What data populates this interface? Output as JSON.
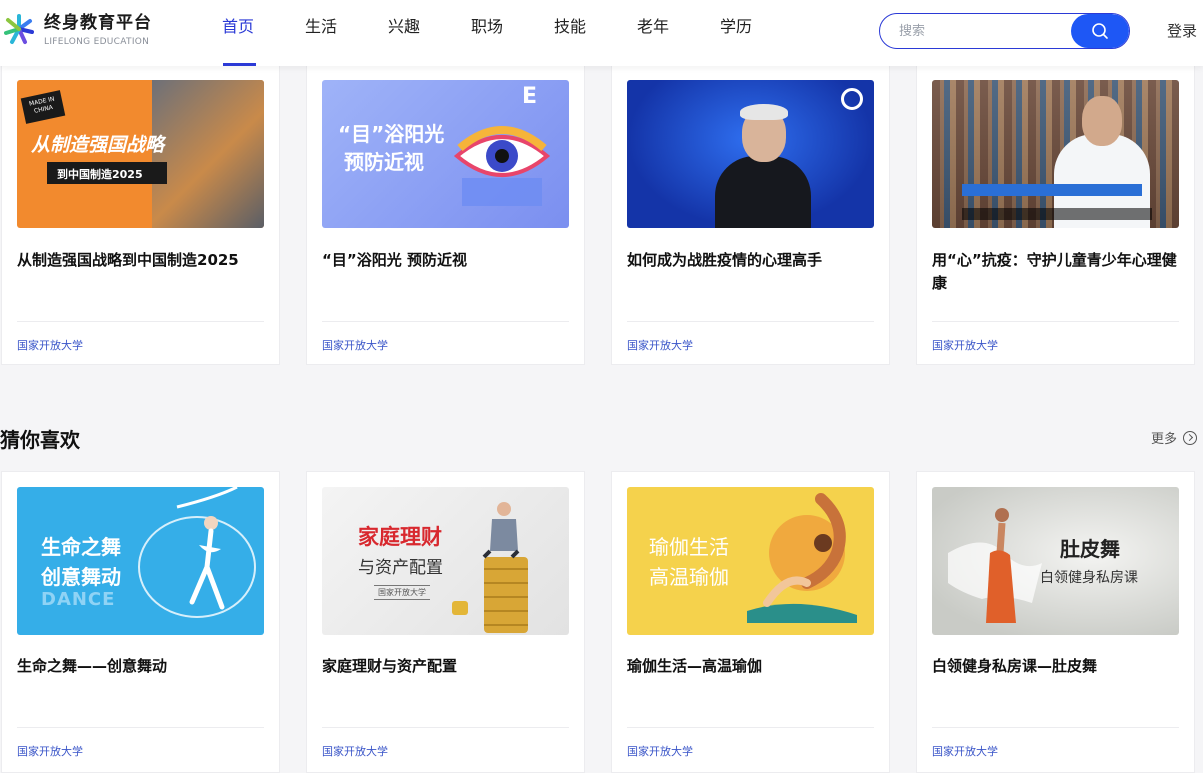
{
  "header": {
    "logo_cn": "终身教育平台",
    "logo_en": "LIFELONG EDUCATION",
    "nav": [
      "首页",
      "生活",
      "兴趣",
      "职场",
      "技能",
      "老年",
      "学历"
    ],
    "active_nav": "首页",
    "search_placeholder": "搜索",
    "login": "登录"
  },
  "row1": [
    {
      "title": "从制造强国战略到中国制造2025",
      "source": "国家开放大学",
      "thumb": {
        "badge": "MADE IN CHINA",
        "line1": "从制造强国战略",
        "line2": "到中国制造2025"
      }
    },
    {
      "title": "“目”浴阳光 预防近视",
      "source": "国家开放大学",
      "thumb": {
        "line1": "“目”浴阳光",
        "line2": "预防近视"
      }
    },
    {
      "title": "如何成为战胜疫情的心理高手",
      "source": "国家开放大学",
      "thumb": {}
    },
    {
      "title": "用“心”抗疫：守护儿童青少年心理健康",
      "source": "国家开放大学",
      "thumb": {}
    }
  ],
  "section": {
    "title": "猜你喜欢",
    "more": "更多"
  },
  "row2": [
    {
      "title": "生命之舞——创意舞动",
      "source": "国家开放大学",
      "thumb": {
        "line1": "生命之舞",
        "line2": "创意舞动",
        "line3": "DANCE"
      }
    },
    {
      "title": "家庭理财与资产配置",
      "source": "国家开放大学",
      "thumb": {
        "line1": "家庭理财",
        "line2": "与资产配置",
        "line3": "国家开放大学"
      }
    },
    {
      "title": "瑜伽生活—高温瑜伽",
      "source": "国家开放大学",
      "thumb": {
        "line1": "瑜伽生活",
        "line2": "高温瑜伽"
      }
    },
    {
      "title": "白领健身私房课—肚皮舞",
      "source": "国家开放大学",
      "thumb": {
        "line1": "肚皮舞",
        "line2": "白领健身私房课"
      }
    }
  ],
  "colors": {
    "accent": "#2b3ad6",
    "search_button": "#1e57f5",
    "source_text": "#3a55c8"
  }
}
